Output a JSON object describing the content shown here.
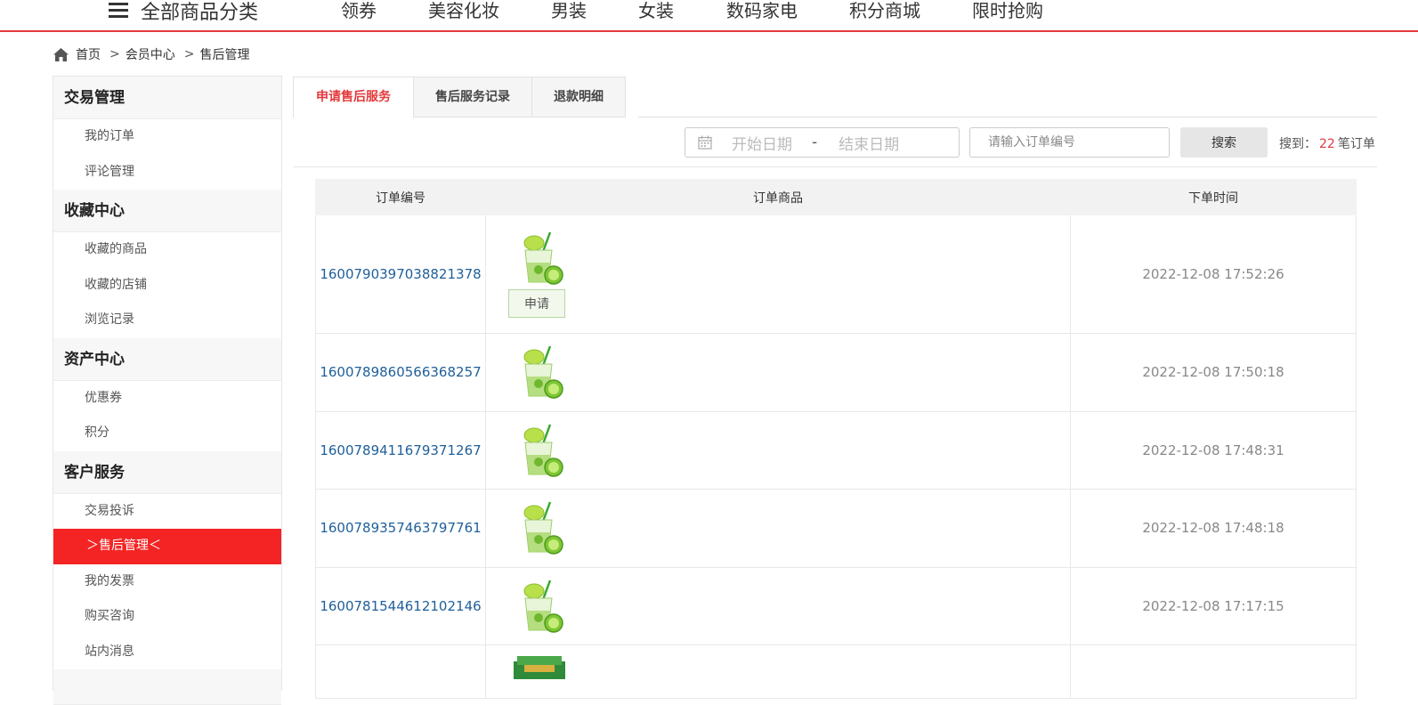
{
  "topnav": {
    "category_label": "全部商品分类",
    "items": [
      "领券",
      "美容化妆",
      "男装",
      "女装",
      "数码家电",
      "积分商城",
      "限时抢购"
    ]
  },
  "breadcrumb": [
    "首页",
    "会员中心",
    "售后管理"
  ],
  "sidebar": {
    "groups": [
      {
        "title": "交易管理",
        "items": [
          "我的订单",
          "评论管理"
        ]
      },
      {
        "title": "收藏中心",
        "items": [
          "收藏的商品",
          "收藏的店铺",
          "浏览记录"
        ]
      },
      {
        "title": "资产中心",
        "items": [
          "优惠券",
          "积分"
        ]
      },
      {
        "title": "客户服务",
        "items": [
          "交易投诉",
          "＞售后管理＜",
          "我的发票",
          "购买咨询",
          "站内消息"
        ]
      }
    ],
    "active_item": "＞售后管理＜"
  },
  "tabs": [
    "申请售后服务",
    "售后服务记录",
    "退款明细"
  ],
  "search": {
    "start_placeholder": "开始日期",
    "date_sep": "-",
    "end_placeholder": "结束日期",
    "order_placeholder": "请输入订单编号",
    "button_label": "搜索",
    "result_prefix": "搜到：",
    "result_count": "22",
    "result_suffix": "笔订单"
  },
  "table": {
    "headers": [
      "订单编号",
      "订单商品",
      "下单时间"
    ],
    "apply_label": "申请",
    "rows": [
      {
        "order_no": "1600790397038821378",
        "time": "2022-12-08 17:52:26"
      },
      {
        "order_no": "1600789860566368257",
        "time": "2022-12-08 17:50:18"
      },
      {
        "order_no": "1600789411679371267",
        "time": "2022-12-08 17:48:31"
      },
      {
        "order_no": "1600789357463797761",
        "time": "2022-12-08 17:48:18"
      },
      {
        "order_no": "1600781544612102146",
        "time": "2022-12-08 17:17:15"
      }
    ]
  },
  "colors": {
    "accent": "#e4393c",
    "active_bg": "#f42424",
    "link": "#1f5f9a"
  }
}
